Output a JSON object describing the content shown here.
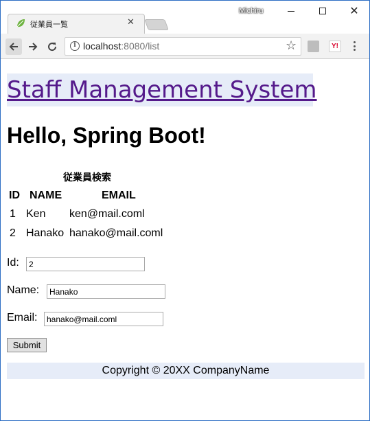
{
  "window": {
    "user_name": "Michiru",
    "minimize_icon": "minimize-icon",
    "maximize_icon": "maximize-icon",
    "close_glyph": "✕"
  },
  "tab": {
    "title": "従業員一覧",
    "icon": "spring-leaf-icon",
    "close_glyph": "✕"
  },
  "toolbar": {
    "back_icon": "back-arrow-icon",
    "forward_icon": "forward-arrow-icon",
    "reload_icon": "reload-icon",
    "url_host": "localhost",
    "url_rest": ":8080/list",
    "info_glyph": "i",
    "star_glyph": "☆",
    "yahoo_label": "Y!"
  },
  "page": {
    "site_title": "Staff Management System",
    "greeting": "Hello, Spring Boot!",
    "table": {
      "caption": "従業員検索",
      "headers": [
        "ID",
        "NAME",
        "EMAIL"
      ],
      "rows": [
        {
          "id": "1",
          "name": "Ken",
          "email": "ken@mail.coml"
        },
        {
          "id": "2",
          "name": "Hanako",
          "email": "hanako@mail.coml"
        }
      ]
    },
    "form": {
      "id_label": "Id:",
      "id_value": "2",
      "name_label": "Name:",
      "name_value": "Hanako",
      "email_label": "Email:",
      "email_value": "hanako@mail.coml",
      "submit_label": "Submit"
    },
    "footer": "Copyright © 20XX CompanyName"
  },
  "colors": {
    "link_visited": "#551a8b",
    "header_bg": "#e6ecf8",
    "window_border": "#2b6cc4"
  }
}
